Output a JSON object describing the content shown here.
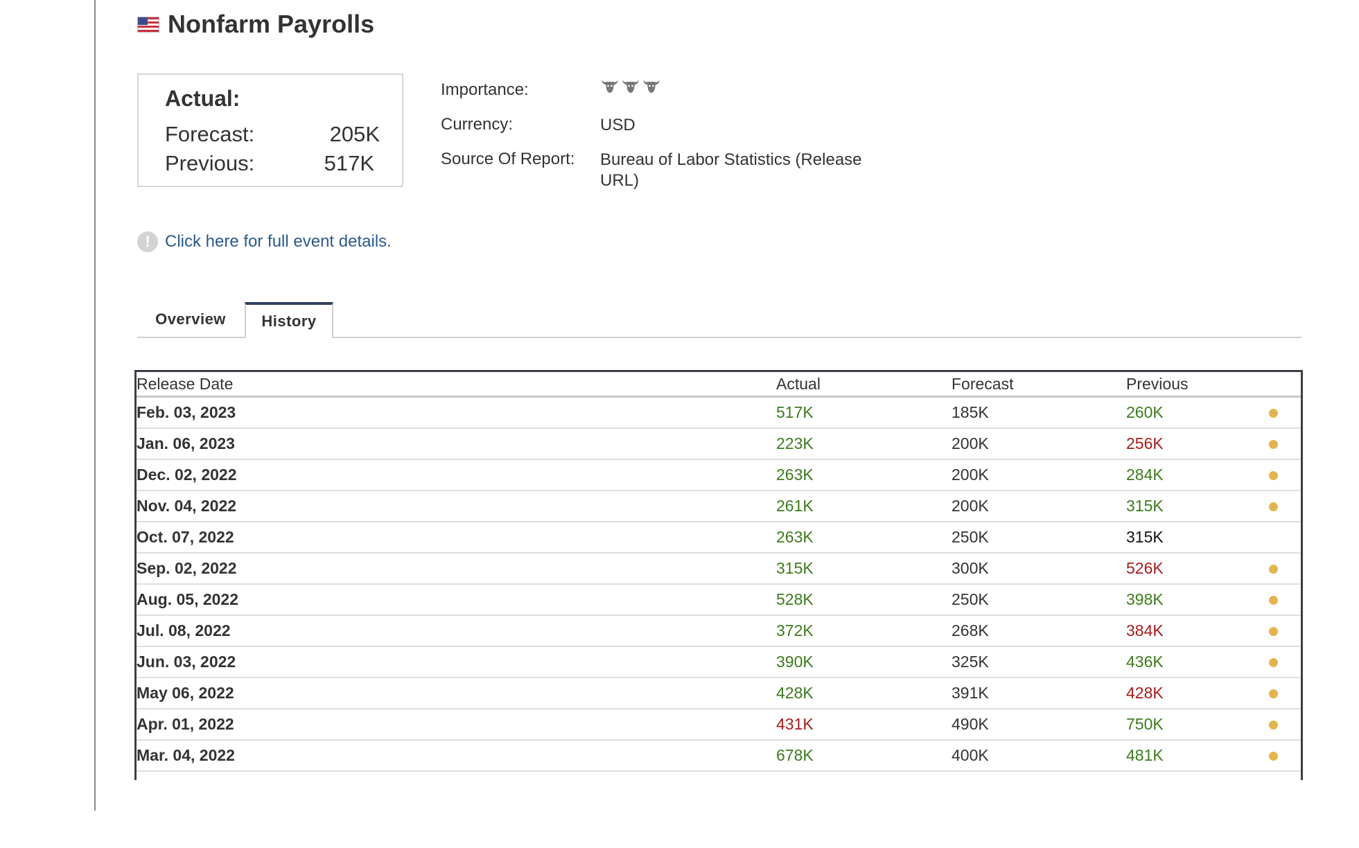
{
  "event": {
    "title": "Nonfarm Payrolls",
    "flag": "us-flag-icon"
  },
  "summary": {
    "actual_label": "Actual:",
    "forecast_label": "Forecast:",
    "forecast_value": "205K",
    "previous_label": "Previous:",
    "previous_value": "517K"
  },
  "info": {
    "importance_label": "Importance:",
    "importance_level": 3,
    "currency_label": "Currency:",
    "currency_value": "USD",
    "source_label": "Source Of Report:",
    "source_value": "Bureau of Labor Statistics (Release URL)"
  },
  "details_link": "Click here for full event details.",
  "tabs": [
    {
      "label": "Overview",
      "active": false
    },
    {
      "label": "History",
      "active": true
    }
  ],
  "history": {
    "columns": [
      "Release Date",
      "Actual",
      "Forecast",
      "Previous"
    ],
    "colors": {
      "green": "#3c7a1c",
      "red": "#a51c1c",
      "dot": "#e4b54f"
    },
    "rows": [
      {
        "date": "Feb. 03, 2023",
        "actual": "517K",
        "actual_color": "green",
        "forecast": "185K",
        "previous": "260K",
        "previous_color": "green",
        "dot": true
      },
      {
        "date": "Jan. 06, 2023",
        "actual": "223K",
        "actual_color": "green",
        "forecast": "200K",
        "previous": "256K",
        "previous_color": "red",
        "dot": true
      },
      {
        "date": "Dec. 02, 2022",
        "actual": "263K",
        "actual_color": "green",
        "forecast": "200K",
        "previous": "284K",
        "previous_color": "green",
        "dot": true
      },
      {
        "date": "Nov. 04, 2022",
        "actual": "261K",
        "actual_color": "green",
        "forecast": "200K",
        "previous": "315K",
        "previous_color": "green",
        "dot": true
      },
      {
        "date": "Oct. 07, 2022",
        "actual": "263K",
        "actual_color": "green",
        "forecast": "250K",
        "previous": "315K",
        "previous_color": "black",
        "dot": false
      },
      {
        "date": "Sep. 02, 2022",
        "actual": "315K",
        "actual_color": "green",
        "forecast": "300K",
        "previous": "526K",
        "previous_color": "red",
        "dot": true
      },
      {
        "date": "Aug. 05, 2022",
        "actual": "528K",
        "actual_color": "green",
        "forecast": "250K",
        "previous": "398K",
        "previous_color": "green",
        "dot": true
      },
      {
        "date": "Jul. 08, 2022",
        "actual": "372K",
        "actual_color": "green",
        "forecast": "268K",
        "previous": "384K",
        "previous_color": "red",
        "dot": true
      },
      {
        "date": "Jun. 03, 2022",
        "actual": "390K",
        "actual_color": "green",
        "forecast": "325K",
        "previous": "436K",
        "previous_color": "green",
        "dot": true
      },
      {
        "date": "May 06, 2022",
        "actual": "428K",
        "actual_color": "green",
        "forecast": "391K",
        "previous": "428K",
        "previous_color": "red",
        "dot": true
      },
      {
        "date": "Apr. 01, 2022",
        "actual": "431K",
        "actual_color": "red",
        "forecast": "490K",
        "previous": "750K",
        "previous_color": "green",
        "dot": true
      },
      {
        "date": "Mar. 04, 2022",
        "actual": "678K",
        "actual_color": "green",
        "forecast": "400K",
        "previous": "481K",
        "previous_color": "green",
        "dot": true
      }
    ]
  }
}
